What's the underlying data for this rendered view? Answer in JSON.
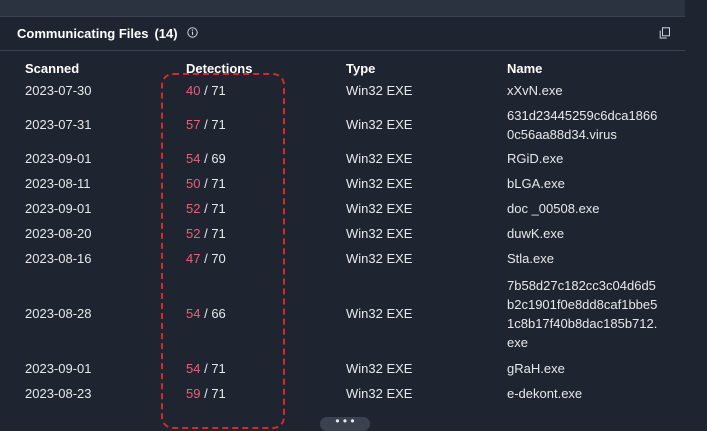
{
  "section": {
    "title": "Communicating Files",
    "count": "(14)",
    "info_icon": "info-icon",
    "copy_icon": "copy-icon"
  },
  "columns": [
    "Scanned",
    "Detections",
    "Type",
    "Name"
  ],
  "rows": [
    {
      "scanned": "2023-07-30",
      "positives": "40",
      "total": "/ 71",
      "type": "Win32 EXE",
      "name": "xXvN.exe"
    },
    {
      "scanned": "2023-07-31",
      "positives": "57",
      "total": "/ 71",
      "type": "Win32 EXE",
      "name": "631d23445259c6dca18660c56aa88d34.virus"
    },
    {
      "scanned": "2023-09-01",
      "positives": "54",
      "total": "/ 69",
      "type": "Win32 EXE",
      "name": "RGiD.exe"
    },
    {
      "scanned": "2023-08-11",
      "positives": "50",
      "total": "/ 71",
      "type": "Win32 EXE",
      "name": "bLGA.exe"
    },
    {
      "scanned": "2023-09-01",
      "positives": "52",
      "total": "/ 71",
      "type": "Win32 EXE",
      "name": "doc _00508.exe"
    },
    {
      "scanned": "2023-08-20",
      "positives": "52",
      "total": "/ 71",
      "type": "Win32 EXE",
      "name": "duwK.exe"
    },
    {
      "scanned": "2023-08-16",
      "positives": "47",
      "total": "/ 70",
      "type": "Win32 EXE",
      "name": "Stla.exe"
    },
    {
      "scanned": "2023-08-28",
      "positives": "54",
      "total": "/ 66",
      "type": "Win32 EXE",
      "name": "7b58d27c182cc3c04d6d5b2c1901f0e8dd8caf1bbe51c8b17f40b8dac185b712.exe"
    },
    {
      "scanned": "2023-09-01",
      "positives": "54",
      "total": "/ 71",
      "type": "Win32 EXE",
      "name": "gRaH.exe"
    },
    {
      "scanned": "2023-08-23",
      "positives": "59",
      "total": "/ 71",
      "type": "Win32 EXE",
      "name": "e-dekont.exe"
    }
  ],
  "load_more_label": "• • •",
  "colors": {
    "positives": "#e8607a",
    "highlight": "#d42a2a",
    "background": "#1f2530"
  }
}
